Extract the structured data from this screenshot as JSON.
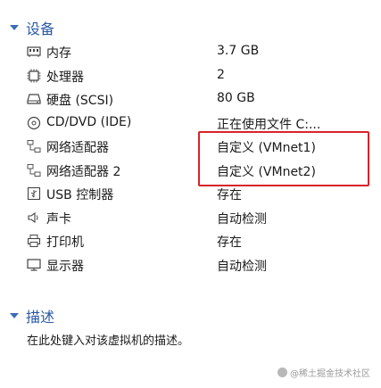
{
  "sections": {
    "devices_title": "设备",
    "description_title": "描述"
  },
  "devices": [
    {
      "icon": "memory-icon",
      "name": "内存",
      "value": "3.7 GB"
    },
    {
      "icon": "processor-icon",
      "name": "处理器",
      "value": "2"
    },
    {
      "icon": "hard-disk-icon",
      "name": "硬盘 (SCSI)",
      "value": "80 GB"
    },
    {
      "icon": "cd-dvd-icon",
      "name": "CD/DVD (IDE)",
      "value": "正在使用文件 C:..."
    },
    {
      "icon": "network-adapter-icon",
      "name": "网络适配器",
      "value": "自定义 (VMnet1)"
    },
    {
      "icon": "network-adapter-icon",
      "name": "网络适配器 2",
      "value": "自定义 (VMnet2)"
    },
    {
      "icon": "usb-icon",
      "name": "USB 控制器",
      "value": "存在"
    },
    {
      "icon": "sound-card-icon",
      "name": "声卡",
      "value": "自动检测"
    },
    {
      "icon": "printer-icon",
      "name": "打印机",
      "value": "存在"
    },
    {
      "icon": "display-icon",
      "name": "显示器",
      "value": "自动检测"
    }
  ],
  "description": {
    "placeholder": "在此处键入对该虚拟机的描述。"
  },
  "watermark": "@稀土掘金技术社区",
  "colors": {
    "section_title": "#2a5aa6",
    "highlight_border": "#d8232a"
  }
}
